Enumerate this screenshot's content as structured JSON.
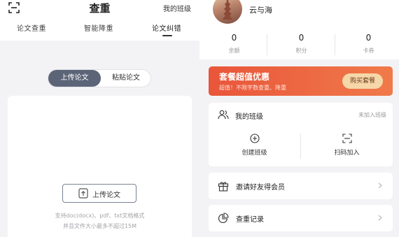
{
  "left": {
    "header_title": "查重",
    "my_class": "我的班级",
    "tabs": [
      {
        "label": "论文查重"
      },
      {
        "label": "智能降重"
      },
      {
        "label": "论文纠错",
        "active": true
      }
    ],
    "segment": {
      "upload": "上传论文",
      "paste": "粘贴论文",
      "selected": "upload"
    },
    "upload_button": "上传论文",
    "hint_line1": "支持doc(docx)、pdf、txt文档格式",
    "hint_line2": "并且文件大小最多不超过15M"
  },
  "right": {
    "username": "云与海",
    "stats": [
      {
        "value": "0",
        "label": "余额"
      },
      {
        "value": "0",
        "label": "积分"
      },
      {
        "value": "0",
        "label": "卡券"
      }
    ],
    "promo": {
      "title": "套餐超值优惠",
      "subtitle": "超值！不限字数查重、降重",
      "button": "购买套餐",
      "colors": {
        "start": "#e9553a",
        "end": "#f07a4a",
        "button_bg": "#f6d7a8"
      }
    },
    "class_card": {
      "title": "我的班级",
      "status": "未加入班级",
      "actions": [
        {
          "label": "创建班级",
          "icon": "plus-circle-icon"
        },
        {
          "label": "扫码加入",
          "icon": "scan-icon"
        }
      ]
    },
    "rows": [
      {
        "label": "邀请好友得会员",
        "icon": "gift-icon"
      },
      {
        "label": "查重记录",
        "icon": "pie-chart-icon"
      }
    ]
  },
  "colors": {
    "accent": "#5c6578",
    "background": "#f3f3f5"
  }
}
